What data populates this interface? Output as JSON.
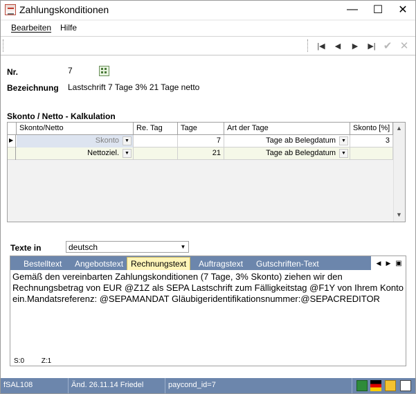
{
  "window": {
    "title": "Zahlungskonditionen",
    "minimize_icon": "minimize-icon",
    "maximize_icon": "maximize-icon",
    "close_icon": "close-icon",
    "minimize_glyph": "—",
    "maximize_glyph": "☐",
    "close_glyph": "✕"
  },
  "menu": {
    "items": [
      {
        "label": "Bearbeiten"
      },
      {
        "label": "Hilfe"
      }
    ]
  },
  "toolbar": {
    "first_glyph": "|◀",
    "prev_glyph": "◀",
    "next_glyph": "▶",
    "last_glyph": "▶|",
    "confirm_glyph": "✔",
    "cancel_glyph": "✕"
  },
  "form": {
    "nr_label": "Nr.",
    "nr_value": "7",
    "bezeichnung_label": "Bezeichnung",
    "bezeichnung_value": "Lastschrift 7 Tage 3%  21 Tage netto",
    "section_title": "Skonto / Netto - Kalkulation"
  },
  "grid": {
    "columns": [
      "Skonto/Netto",
      "Re. Tag",
      "Tage",
      "Art der Tage",
      "Skonto [%]"
    ],
    "rows": [
      {
        "indicator": "▶",
        "skonto_netto": "Skonto",
        "re_tag": "",
        "tage": "7",
        "art": "Tage ab Belegdatum",
        "skonto_pct": "3"
      },
      {
        "indicator": "",
        "skonto_netto": "Nettoziel.",
        "re_tag": "",
        "tage": "21",
        "art": "Tage ab Belegdatum",
        "skonto_pct": ""
      }
    ]
  },
  "texte": {
    "label": "Texte in",
    "language": "deutsch",
    "tabs": [
      "Bestelltext",
      "Angebotstext",
      "Rechnungstext",
      "Auftragstext",
      "Gutschriften-Text"
    ],
    "active_tab": "Rechnungstext",
    "body": "Gemäß den vereinbarten Zahlungskonditionen (7 Tage, 3% Skonto) ziehen wir den\nRechnungsbetrag von EUR @Z1Z als SEPA Lastschrift zum Fälligkeitstag @F1Y von Ihrem Konto\nein.Mandatsreferenz: @SEPAMANDAT Gläubigeridentifikationsnummer:@SEPACREDITOR",
    "status_s": "S:0",
    "status_z": "Z:1"
  },
  "statusbar": {
    "form_id": "fSAL108",
    "changed": "Änd. 26.11.14 Friedel",
    "record": "paycond_id=7"
  },
  "colors": {
    "accent": "#6c86ac",
    "active_tab": "#fff5b8",
    "grid_row": "#f5f8e8"
  }
}
